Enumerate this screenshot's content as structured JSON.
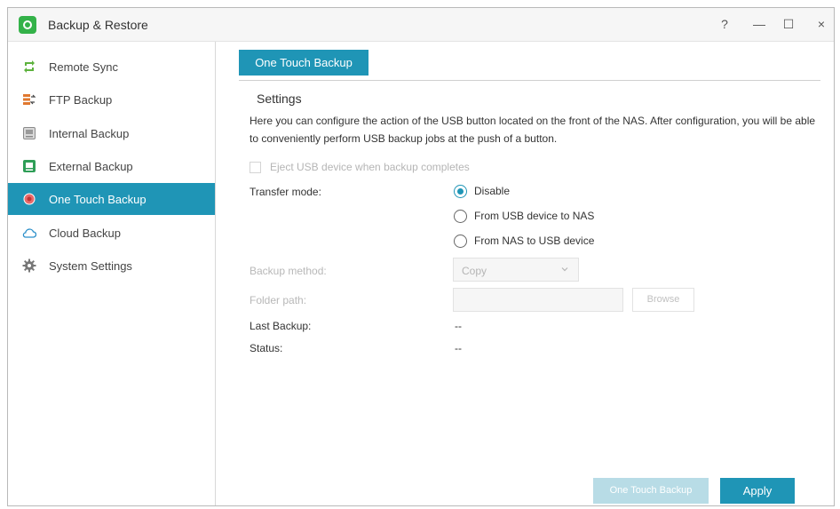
{
  "window": {
    "title": "Backup & Restore",
    "controls": {
      "help": "?",
      "minimize": "—",
      "maximize": "☐",
      "close": "×"
    }
  },
  "sidebar": {
    "items": [
      {
        "label": "Remote Sync",
        "icon": "remote-sync-icon",
        "active": false
      },
      {
        "label": "FTP Backup",
        "icon": "ftp-backup-icon",
        "active": false
      },
      {
        "label": "Internal Backup",
        "icon": "internal-backup-icon",
        "active": false
      },
      {
        "label": "External Backup",
        "icon": "external-backup-icon",
        "active": false
      },
      {
        "label": "One Touch Backup",
        "icon": "one-touch-backup-icon",
        "active": true
      },
      {
        "label": "Cloud Backup",
        "icon": "cloud-icon",
        "active": false
      },
      {
        "label": "System Settings",
        "icon": "gear-icon",
        "active": false
      }
    ]
  },
  "main": {
    "tab_label": "One Touch Backup",
    "section_title": "Settings",
    "description": "Here you can configure the action of the USB button located on the front of the NAS. After configuration, you will be able to conveniently perform USB backup jobs at the push of a button.",
    "eject_checkbox": {
      "label": "Eject USB device when backup completes",
      "checked": false,
      "disabled": true
    },
    "transfer_mode": {
      "label": "Transfer mode:",
      "options": [
        "Disable",
        "From USB device to NAS",
        "From NAS to USB device"
      ],
      "selected": "Disable"
    },
    "backup_method": {
      "label": "Backup method:",
      "value": "Copy"
    },
    "folder_path": {
      "label": "Folder path:",
      "value": "",
      "browse_label": "Browse"
    },
    "last_backup": {
      "label": "Last Backup:",
      "value": "--"
    },
    "status": {
      "label": "Status:",
      "value": "--"
    },
    "buttons": {
      "one_touch_backup": "One Touch Backup",
      "apply": "Apply"
    }
  },
  "colors": {
    "accent": "#1f95b6",
    "accent_disabled": "#b8dce6",
    "app_icon": "#34b249"
  }
}
